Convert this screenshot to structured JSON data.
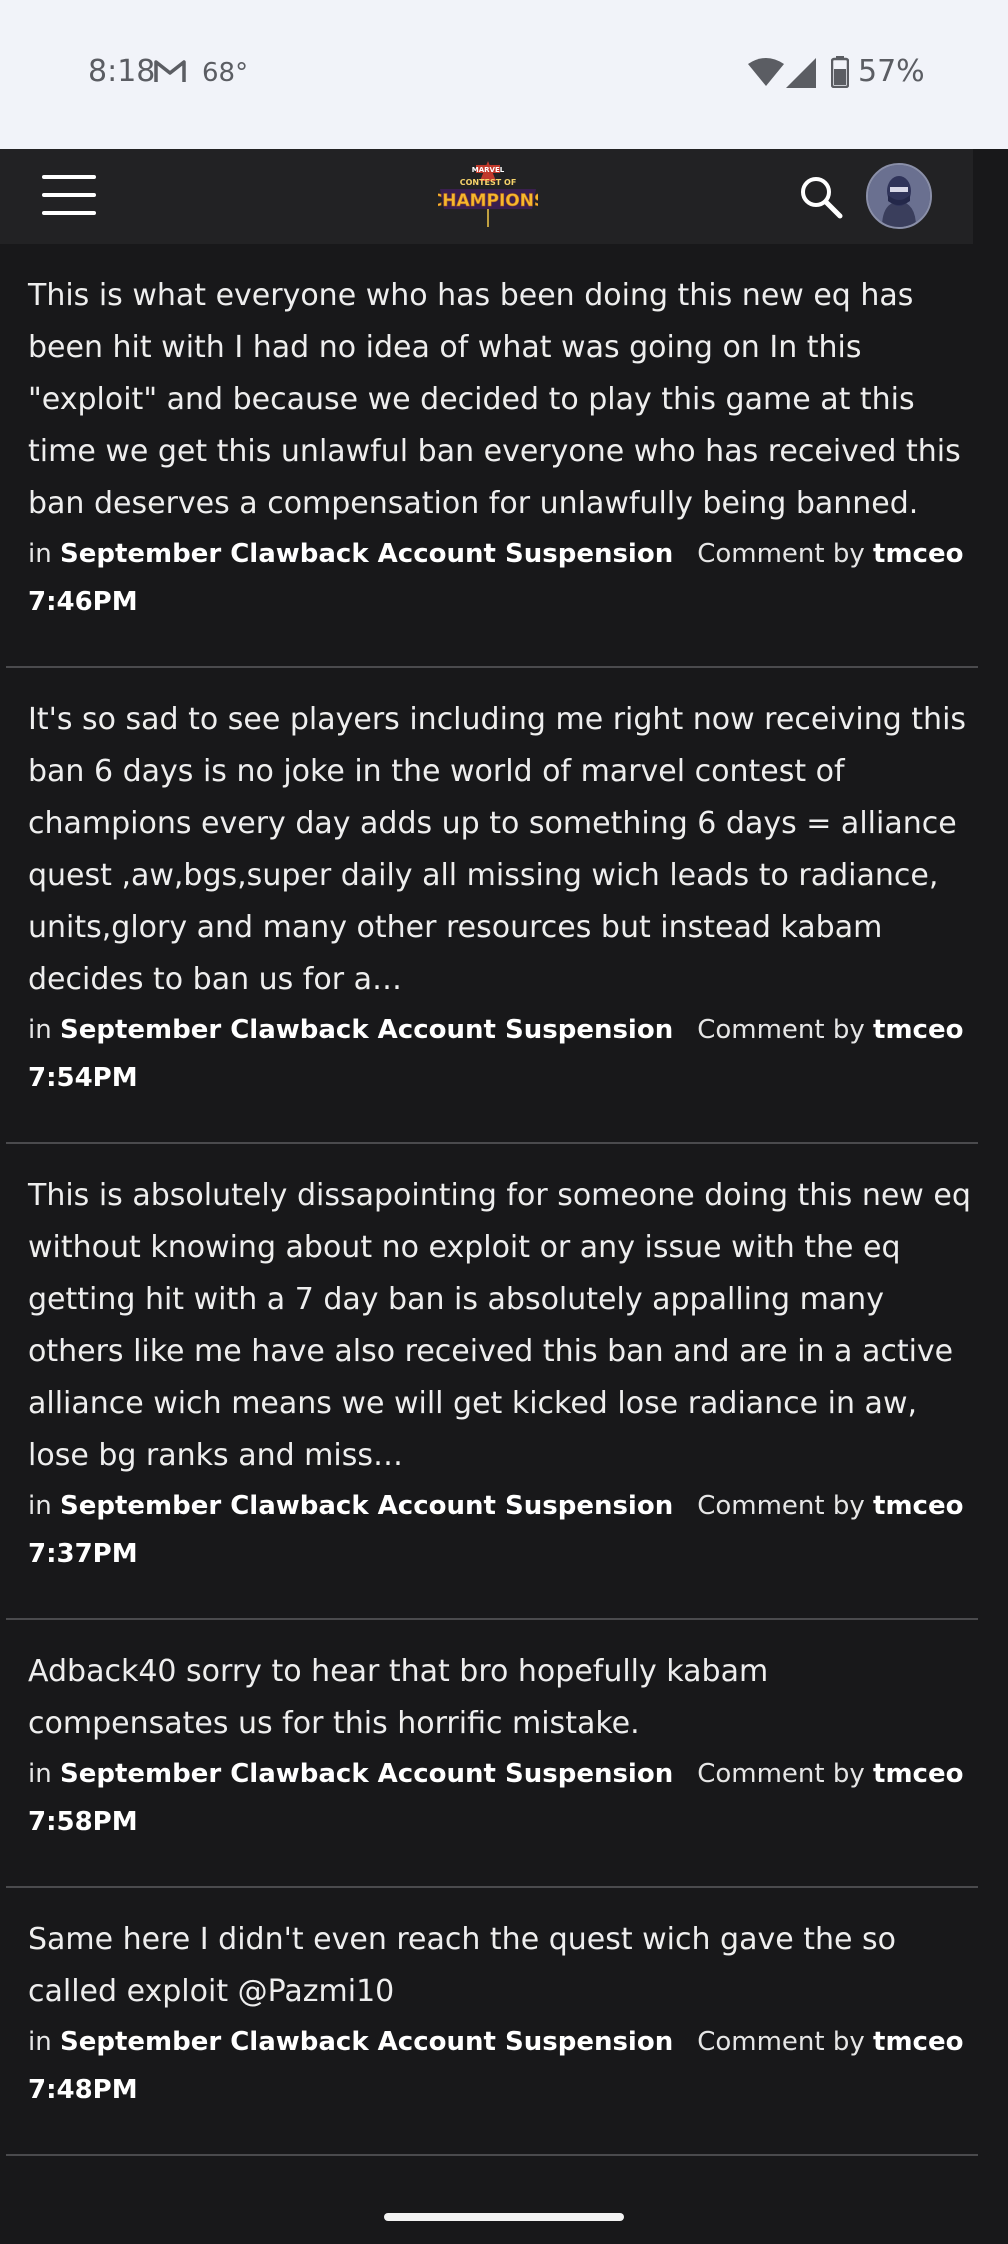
{
  "status": {
    "time": "8:18",
    "temperature": "68°",
    "battery": "57%"
  },
  "header": {
    "logo_top": "MARVEL",
    "logo_mid": "CONTEST OF",
    "logo_main": "CHAMPIONS"
  },
  "comments": [
    {
      "body": "This is what everyone who has been doing this new eq has been hit with I had no idea of what was going on In this \"exploit\" and because we decided to play this game at this time we get this unlawful ban everyone who has received this ban deserves a compensation for unlawfully being banned.",
      "in_label": "in",
      "thread": "September Clawback Account Suspension",
      "by_label": "Comment by",
      "author": "tmceo",
      "time": "7:46PM"
    },
    {
      "body": "It's so sad to see players including me right now receiving this ban 6 days is no joke in the world of marvel contest of champions every day adds up to something 6 days = alliance quest ,aw,bgs,super daily all missing wich leads to radiance, units,glory and many other resources but instead kabam decides to ban us for a…",
      "in_label": "in",
      "thread": "September Clawback Account Suspension",
      "by_label": "Comment by",
      "author": "tmceo",
      "time": "7:54PM"
    },
    {
      "body": "This is absolutely dissapointing for someone doing this new eq without knowing about no exploit or any issue with the eq getting hit with a 7 day ban is absolutely appalling many others like me have also received this ban and are in a active alliance wich means we will get kicked lose radiance in aw, lose bg ranks and miss…",
      "in_label": "in",
      "thread": "September Clawback Account Suspension",
      "by_label": "Comment by",
      "author": "tmceo",
      "time": "7:37PM"
    },
    {
      "body": "Adback40 sorry to hear that bro hopefully kabam compensates us for this horrific mistake.",
      "in_label": "in",
      "thread": "September Clawback Account Suspension",
      "by_label": "Comment by",
      "author": "tmceo",
      "time": "7:58PM"
    },
    {
      "body": "Same here I didn't even reach the quest wich gave the so called exploit @Pazmi10",
      "in_label": "in",
      "thread": "September Clawback Account Suspension",
      "by_label": "Comment by",
      "author": "tmceo",
      "time": "7:48PM"
    }
  ]
}
